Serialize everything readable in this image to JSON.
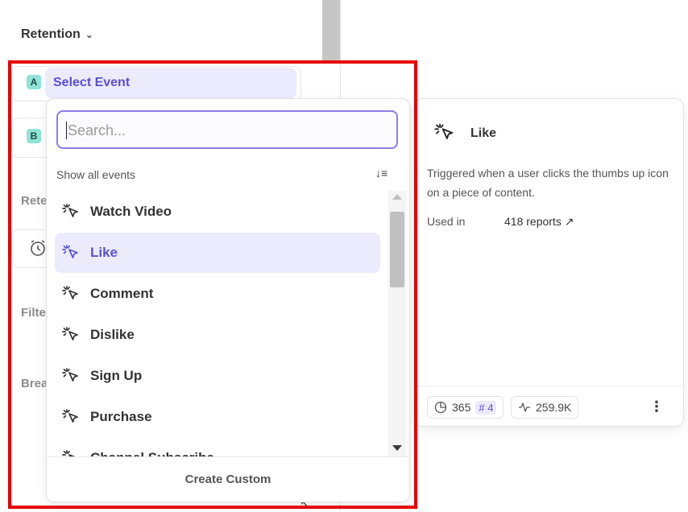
{
  "sidebar": {
    "retention_title": "Retention",
    "chevron": "⌄",
    "badge_a": "A",
    "badge_b": "B",
    "select_event": "Select Event",
    "label_rete": "Rete",
    "label_filte": "Filte",
    "label_brea": "Brea"
  },
  "dropdown": {
    "search_placeholder": "Search...",
    "show_all": "Show all events",
    "sort_icon": "↓≡",
    "items": [
      {
        "label": "Watch Video",
        "icon": "click-icon"
      },
      {
        "label": "Like",
        "icon": "click-icon",
        "selected": true
      },
      {
        "label": "Comment",
        "icon": "click-icon"
      },
      {
        "label": "Dislike",
        "icon": "click-icon"
      },
      {
        "label": "Sign Up",
        "icon": "click-icon"
      },
      {
        "label": "Purchase",
        "icon": "click-icon"
      },
      {
        "label": "Channel Subscribe",
        "icon": "click-icon"
      }
    ],
    "footer": "Create Custom"
  },
  "detail": {
    "title": "Like",
    "description": "Triggered when a user clicks the thumbs up icon on a piece of content.",
    "used_in_label": "Used in",
    "used_in_value": "418 reports ↗",
    "stat1_value": "365",
    "stat1_hash": "# 4",
    "stat2_value": "259.9K",
    "more": "⋮"
  },
  "colors": {
    "accent": "#5a4fd6",
    "accent_bg": "#ecebfd",
    "highlight": "#e60000",
    "badge": "#8fe3d6"
  }
}
